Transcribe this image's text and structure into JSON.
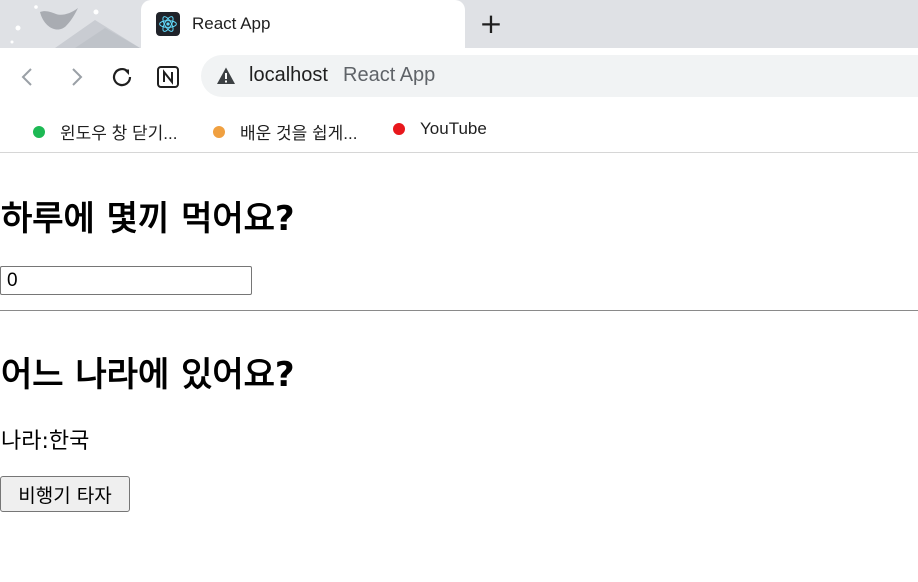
{
  "browser": {
    "tab": {
      "title": "React App"
    },
    "newtab_symbol": "+",
    "address": {
      "host": "localhost",
      "page_title": "React App"
    },
    "bookmarks": [
      {
        "label": "윈도우 창 닫기...",
        "color": "#1db954"
      },
      {
        "label": "배운 것을 쉽게...",
        "color": "#f0a040"
      },
      {
        "label": "YouTube",
        "color": "#e8171c"
      }
    ]
  },
  "page": {
    "meals_heading": "하루에 몇끼 먹어요?",
    "meals_value": "0",
    "country_heading": "어느 나라에 있어요?",
    "country_label": "나라:",
    "country_value": "한국",
    "fly_button": "비행기 타자"
  }
}
